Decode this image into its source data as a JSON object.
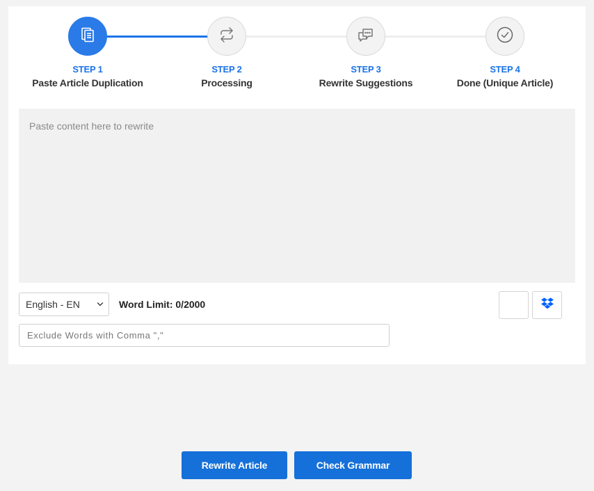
{
  "steps": [
    {
      "number": "STEP 1",
      "title": "Paste Article Duplication",
      "icon": "clipboard-icon",
      "active": true
    },
    {
      "number": "STEP 2",
      "title": "Processing",
      "icon": "repeat-icon",
      "active": false
    },
    {
      "number": "STEP 3",
      "title": "Rewrite Suggestions",
      "icon": "chat-icon",
      "active": false
    },
    {
      "number": "STEP 4",
      "title": "Done (Unique Article)",
      "icon": "check-circle-icon",
      "active": false
    }
  ],
  "editor": {
    "placeholder": "Paste content here to rewrite",
    "value": ""
  },
  "language": {
    "selected": "English - EN"
  },
  "word_limit": "Word Limit: 0/2000",
  "exclude": {
    "placeholder": "Exclude Words with Comma \",\"",
    "value": ""
  },
  "upload": {
    "file_icon": "blank-upload-icon",
    "dropbox_icon": "dropbox-icon"
  },
  "actions": {
    "rewrite": "Rewrite Article",
    "grammar": "Check Grammar"
  },
  "colors": {
    "accent": "#1570d9",
    "active_step": "#2a7ae8",
    "dropbox": "#0061fe"
  }
}
